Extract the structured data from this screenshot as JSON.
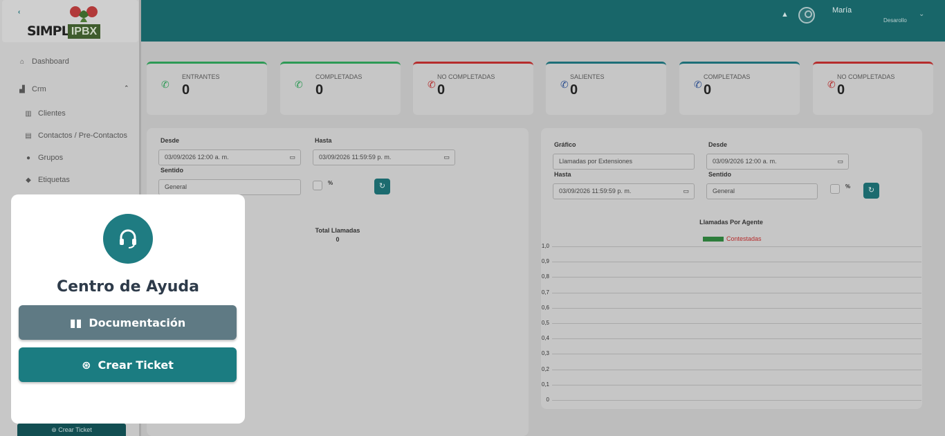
{
  "logo": {
    "text": "SIMPLE",
    "box": "IPBX"
  },
  "sidebar": {
    "collapse": "‹",
    "items": [
      {
        "label": "Dashboard"
      },
      {
        "label": "Crm"
      },
      {
        "label": "Clientes"
      },
      {
        "label": "Contactos / Pre-Contactos"
      },
      {
        "label": "Grupos"
      },
      {
        "label": "Etiquetas"
      }
    ]
  },
  "topbar": {
    "user_name": "María",
    "user_role": "Desarollo"
  },
  "cards": [
    {
      "label": "ENTRANTES",
      "value": "0",
      "status": "green"
    },
    {
      "label": "COMPLETADAS",
      "value": "0",
      "status": "green"
    },
    {
      "label": "NO COMPLETADAS",
      "value": "0",
      "status": "red"
    },
    {
      "label": "SALIENTES",
      "value": "0",
      "status": "teal"
    },
    {
      "label": "COMPLETADAS",
      "value": "0",
      "status": "teal"
    },
    {
      "label": "NO COMPLETADAS",
      "value": "0",
      "status": "red"
    }
  ],
  "left_panel": {
    "desde_label": "Desde",
    "desde_value": "03/09/2026 12:00  a. m.",
    "hasta_label": "Hasta",
    "hasta_value": "03/09/2026 11:59:59  p. m.",
    "sentido_label": "Sentido",
    "sentido_value": "General",
    "percent_label": "%",
    "total_label": "Total Llamadas",
    "total_value": "0"
  },
  "right_panel": {
    "grafico_label": "Gráfico",
    "grafico_value": "Llamadas por Extensiones",
    "desde_label": "Desde",
    "desde_value": "03/09/2026 12:00  a. m.",
    "hasta_label": "Hasta",
    "hasta_value": "03/09/2026 11:59:59  p. m.",
    "sentido_label": "Sentido",
    "sentido_value": "General",
    "percent_label": "%",
    "chart_title": "Llamadas Por Agente",
    "legend": "Contestadas"
  },
  "chart_data": {
    "type": "bar",
    "title": "Llamadas Por Agente",
    "categories": [],
    "series": [
      {
        "name": "Contestadas",
        "values": []
      }
    ],
    "ylim": [
      0,
      1.0
    ],
    "yticks": [
      "1,0",
      "0,9",
      "0,8",
      "0,7",
      "0,6",
      "0,5",
      "0,4",
      "0,3",
      "0,2",
      "0,1",
      "0"
    ],
    "legend_position": "top-center",
    "grid": true
  },
  "help": {
    "title": "Centro de Ayuda",
    "doc_button": "Documentación",
    "ticket_button": "Crear Ticket"
  },
  "footer": {
    "ticket_button": "Crear Ticket"
  },
  "colors": {
    "primary": "#1b7c81",
    "green": "#2d9a55",
    "red": "#b52c2c",
    "doc": "#5f7a84"
  }
}
